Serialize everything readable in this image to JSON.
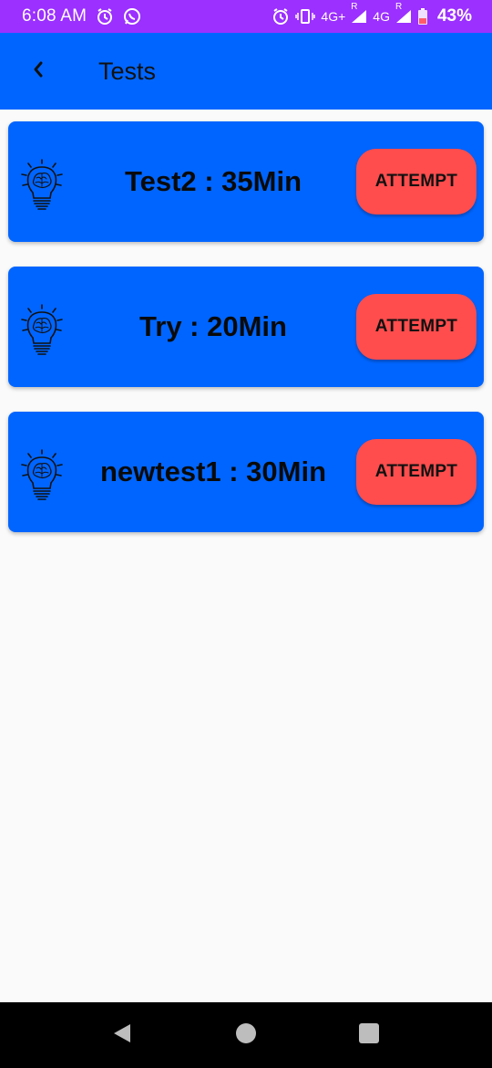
{
  "status_bar": {
    "time": "6:08 AM",
    "network_1": "4G+",
    "roaming_1": "R",
    "network_2": "4G",
    "roaming_2": "R",
    "battery": "43%"
  },
  "app_bar": {
    "back_icon": "chevron-left-icon",
    "title": "Tests"
  },
  "tests": [
    {
      "title": "Test2 : 35Min",
      "button": "ATTEMPT",
      "icon": "lightbulb-brain-icon"
    },
    {
      "title": "Try : 20Min",
      "button": "ATTEMPT",
      "icon": "lightbulb-brain-icon"
    },
    {
      "title": "newtest1 : 30Min",
      "button": "ATTEMPT",
      "icon": "lightbulb-brain-icon"
    }
  ],
  "colors": {
    "status_bar": "#9b30ff",
    "primary": "#0065ff",
    "accent_button": "#ff4d4d",
    "background": "#fafafa"
  },
  "nav_bar": {
    "back": "triangle-back-icon",
    "home": "circle-home-icon",
    "recents": "square-recents-icon"
  }
}
